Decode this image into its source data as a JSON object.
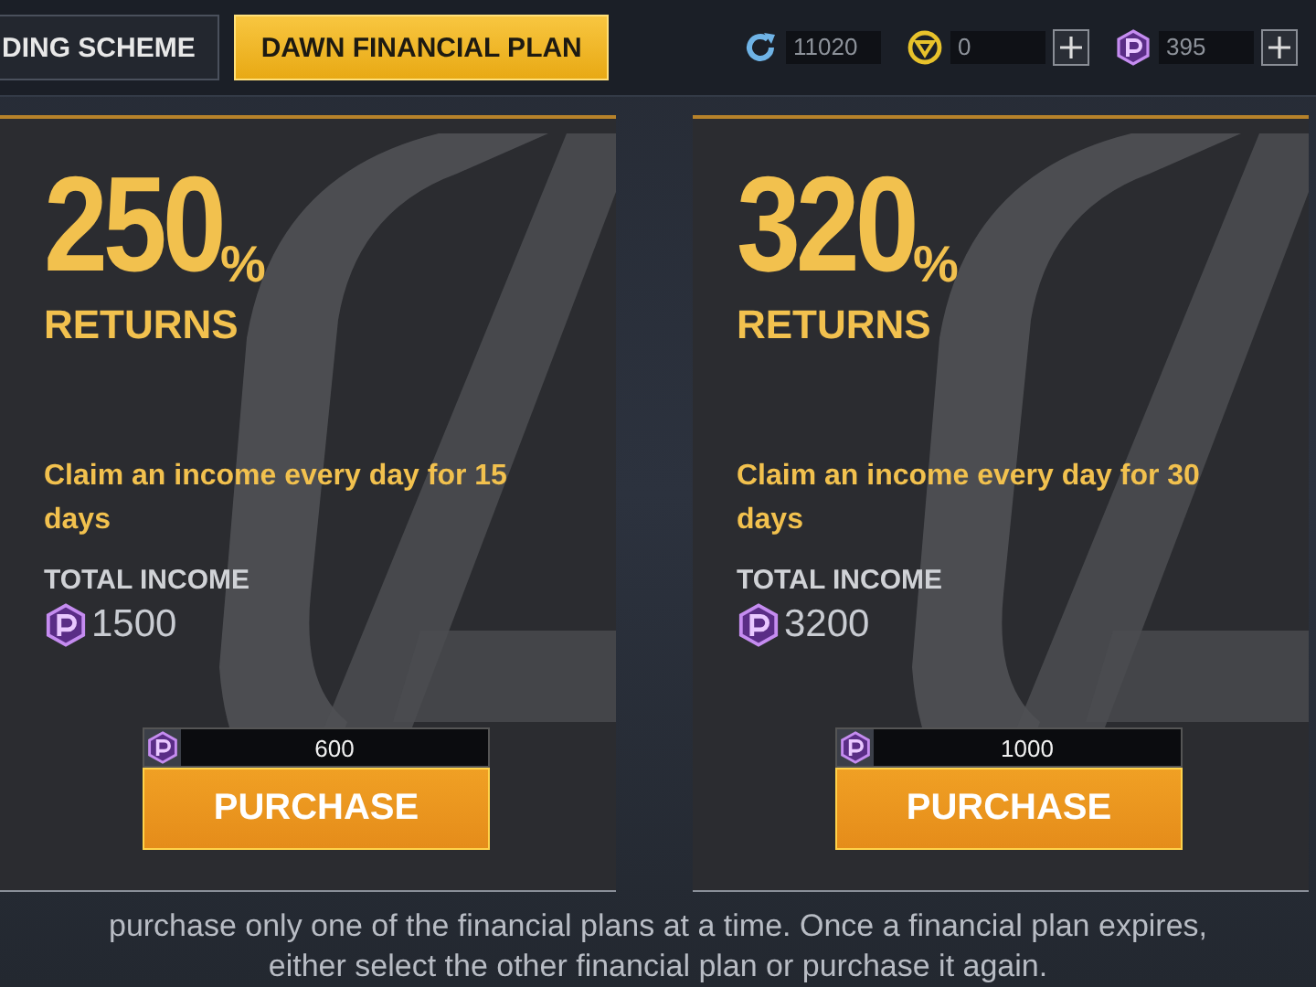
{
  "tabs": [
    {
      "label": "DING SCHEME",
      "selected": false
    },
    {
      "label": "DAWN FINANCIAL PLAN",
      "selected": true
    }
  ],
  "currencies": [
    {
      "kind": "refresh",
      "amount": "11020",
      "addable": false
    },
    {
      "kind": "coin",
      "amount": "0",
      "addable": true
    },
    {
      "kind": "gem",
      "amount": "395",
      "addable": true
    }
  ],
  "plans": [
    {
      "percent": "250",
      "percent_sign": "%",
      "returns_label": "RETURNS",
      "description": "Claim an income every day for 15 days",
      "total_label": "TOTAL INCOME",
      "total": "1500",
      "price": "600",
      "button": "PURCHASE"
    },
    {
      "percent": "320",
      "percent_sign": "%",
      "returns_label": "RETURNS",
      "description": "Claim an income every day for 30 days",
      "total_label": "TOTAL INCOME",
      "total": "3200",
      "price": "1000",
      "button": "PURCHASE"
    }
  ],
  "footer": [
    "purchase only one of the financial plans at a time. Once a financial plan expires,",
    "either select the other financial plan or purchase it again."
  ]
}
